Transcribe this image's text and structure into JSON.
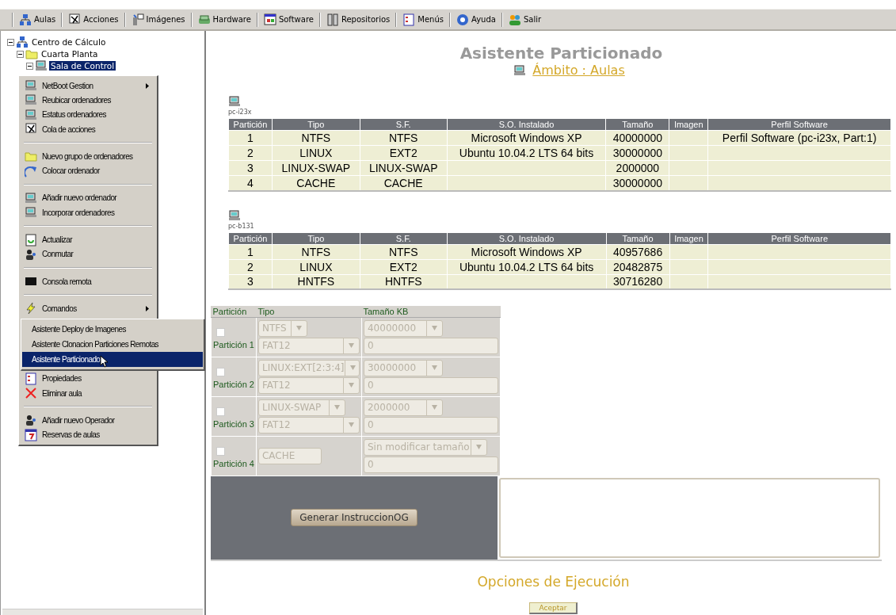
{
  "toolbar": {
    "items": [
      {
        "label": "Aulas"
      },
      {
        "label": "Acciones"
      },
      {
        "label": "Imágenes"
      },
      {
        "label": "Hardware"
      },
      {
        "label": "Software"
      },
      {
        "label": "Repositorios"
      },
      {
        "label": "Menús"
      },
      {
        "label": "Ayuda"
      },
      {
        "label": "Salir"
      }
    ]
  },
  "tree": {
    "label": "Centro de Cálculo",
    "expanded": true,
    "selected": false,
    "children": [
      {
        "label": "Cuarta Planta",
        "expanded": true,
        "selected": false,
        "children": [
          {
            "label": "Sala de Control",
            "expanded": true,
            "selected": true
          }
        ]
      }
    ]
  },
  "context_menu": {
    "groups": [
      [
        {
          "label": "NetBoot Gestion",
          "submenu": true
        },
        {
          "label": "Reubicar ordenadores",
          "submenu": false
        },
        {
          "label": "Estatus ordenadores",
          "submenu": false
        },
        {
          "label": "Cola de acciones",
          "submenu": false
        }
      ],
      [
        {
          "label": "Nuevo grupo de ordenadores",
          "submenu": false
        },
        {
          "label": "Colocar ordenador",
          "submenu": false
        }
      ],
      [
        {
          "label": "Añadir nuevo ordenador",
          "submenu": false
        },
        {
          "label": "Incorporar ordenadores",
          "submenu": false
        }
      ],
      [
        {
          "label": "Actualizar",
          "submenu": false
        },
        {
          "label": "Conmutar",
          "submenu": false
        }
      ],
      [
        {
          "label": "Consola remota",
          "submenu": false
        }
      ],
      [
        {
          "label": "Comandos",
          "submenu": true
        },
        {
          "label": "Propiedades",
          "submenu": false
        },
        {
          "label": "Eliminar aula",
          "submenu": false
        }
      ],
      [
        {
          "label": "Añadir nuevo Operador",
          "submenu": false
        },
        {
          "label": "Reservas de aulas",
          "submenu": false
        }
      ]
    ],
    "submenu": [
      {
        "label": "Asistente Deploy de Imagenes",
        "selected": false
      },
      {
        "label": "Asistente Clonacion Particiones Remotas",
        "selected": false
      },
      {
        "label": "Asistente Particionado",
        "selected": true
      }
    ]
  },
  "main": {
    "title": "Asistente Particionado",
    "scope_link": "Ámbito : Aulas",
    "computers": [
      {
        "name": "pc-i23x",
        "columns": [
          "Partición",
          "Tipo",
          "S.F.",
          "S.O. Instalado",
          "Tamaño",
          "Imagen",
          "Perfil Software"
        ],
        "rows": [
          [
            "1",
            "NTFS",
            "NTFS",
            "Microsoft Windows XP",
            "40000000",
            "",
            "Perfil Software (pc-i23x, Part:1)"
          ],
          [
            "2",
            "LINUX",
            "EXT2",
            "Ubuntu 10.04.2 LTS 64 bits",
            "30000000",
            "",
            ""
          ],
          [
            "3",
            "LINUX-SWAP",
            "LINUX-SWAP",
            "",
            "2000000",
            "",
            ""
          ],
          [
            "4",
            "CACHE",
            "CACHE",
            "",
            "30000000",
            "",
            ""
          ]
        ]
      },
      {
        "name": "pc-b131",
        "columns": [
          "Partición",
          "Tipo",
          "S.F.",
          "S.O. Instalado",
          "Tamaño",
          "Imagen",
          "Perfil Software"
        ],
        "rows": [
          [
            "1",
            "NTFS",
            "NTFS",
            "Microsoft Windows XP",
            "40957686",
            "",
            ""
          ],
          [
            "2",
            "LINUX",
            "EXT2",
            "Ubuntu 10.04.2 LTS 64 bits",
            "20482875",
            "",
            ""
          ],
          [
            "3",
            "HNTFS",
            "HNTFS",
            "",
            "30716280",
            "",
            ""
          ]
        ]
      }
    ],
    "form": {
      "columns": [
        "Partición",
        "Tipo",
        "Tamaño KB"
      ],
      "rows": [
        {
          "kind": "select",
          "checked": false,
          "disabled": true,
          "label": "Partición 1",
          "type": "NTFS",
          "fs": "FAT12",
          "size": "40000000",
          "size_value": "0"
        },
        {
          "kind": "select",
          "checked": false,
          "disabled": true,
          "label": "Partición 2",
          "type": "LINUX:EXT[2:3:4]",
          "fs": "FAT12",
          "size": "30000000",
          "size_value": "0"
        },
        {
          "kind": "select",
          "checked": false,
          "disabled": true,
          "label": "Partición 3",
          "type": "LINUX-SWAP",
          "fs": "FAT12",
          "size": "2000000",
          "size_value": "0"
        },
        {
          "kind": "text",
          "checked": false,
          "disabled": true,
          "label": "Partición 4",
          "type": "CACHE",
          "size": "Sin modificar tamaño",
          "size_value": "0"
        }
      ],
      "generate_button": "Generar InstruccionOG"
    },
    "options_title": "Opciones de Ejecución",
    "accept_button": "Aceptar"
  }
}
